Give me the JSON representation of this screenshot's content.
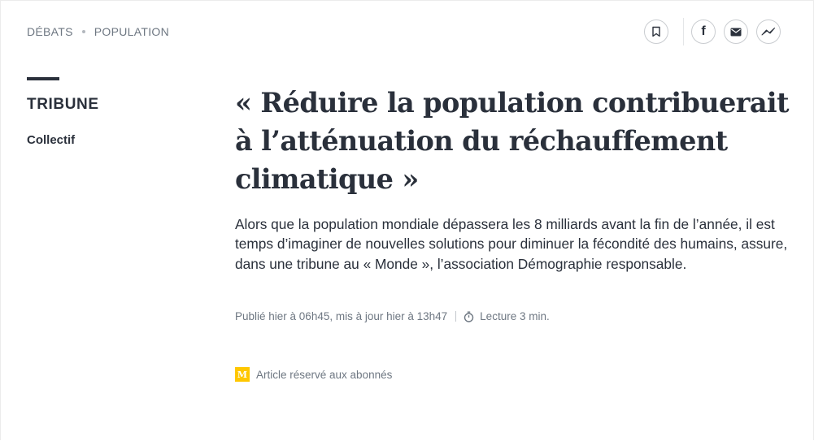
{
  "breadcrumb": {
    "section": "DÉBATS",
    "subsection": "POPULATION"
  },
  "share": {
    "bookmark_icon": "bookmark-icon",
    "facebook_icon": "facebook-icon",
    "facebook_glyph": "f",
    "email_icon": "email-icon",
    "messenger_icon": "messenger-icon"
  },
  "article": {
    "category": "TRIBUNE",
    "author": "Collectif",
    "title": "« Réduire la population contribuerait à l’atténuation du réchauffement climatique »",
    "description": "Alors que la population mondiale dépassera les 8 milliards avant la fin de l’année, il est temps d’imaginer de nouvelles solutions pour diminuer la fécondité des humains, assure, dans une tribune au « Monde », l’association Démographie responsable.",
    "published": "Publié hier à 06h45, mis à jour hier à 13h47",
    "reading_time": "Lecture 3 min.",
    "reading_icon": "stopwatch-icon",
    "subscriber_notice": "Article réservé aux abonnés",
    "subscriber_badge_glyph": "M"
  },
  "colors": {
    "text": "#2a303b",
    "muted": "#6e7782",
    "subscriber_badge": "#ffc700",
    "border": "#c9ccd0"
  }
}
